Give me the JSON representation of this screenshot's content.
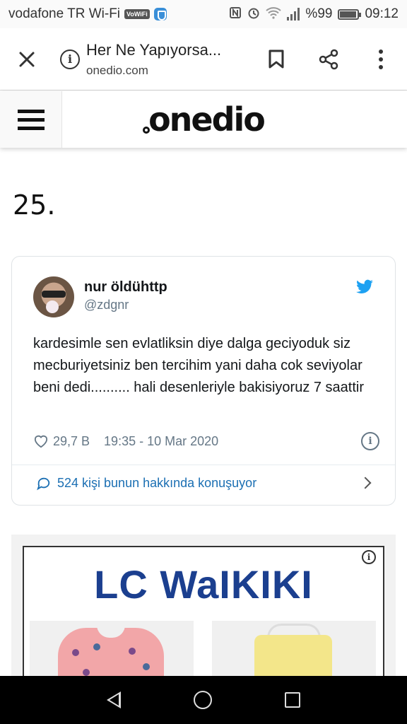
{
  "status_bar": {
    "carrier": "vodafone TR Wi-Fi",
    "vowifi_badge": "VoWiFi",
    "battery": "%99",
    "time": "09:12"
  },
  "browser": {
    "title": "Her Ne Yapıyorsa...",
    "url": "onedio.com"
  },
  "site": {
    "logo": "onedio"
  },
  "article": {
    "item_number": "25."
  },
  "tweet": {
    "name": "nur öldühttp",
    "handle": "@zdgnr",
    "text": "kardesimle sen evlatliksin diye dalga geciyoduk siz mecburiyetsiniz ben tercihim yani daha cok seviyolar beni dedi.......... hali desenleriyle bakisiyoruz 7 saattir",
    "likes": "29,7 B",
    "timestamp": "19:35 - 10 Mar 2020",
    "replies_label": "524 kişi bunun hakkında konuşuyor",
    "accent": "#1da1f2",
    "link_color": "#1b6fb3"
  },
  "ad": {
    "brand": "LC WaIKIKI",
    "brand_color": "#1b3f8f"
  }
}
